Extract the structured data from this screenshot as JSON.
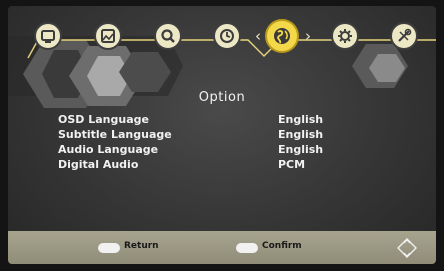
{
  "menu": {
    "title": "Option",
    "items": [
      {
        "label": "OSD Language",
        "value": "English"
      },
      {
        "label": "Subtitle Language",
        "value": "English"
      },
      {
        "label": "Audio Language",
        "value": "English"
      },
      {
        "label": "Digital Audio",
        "value": "PCM"
      }
    ]
  },
  "footer": {
    "return_label": "Return",
    "confirm_label": "Confirm"
  },
  "tabs": [
    {
      "icon": "tv-icon",
      "selected": false
    },
    {
      "icon": "picture-icon",
      "selected": false
    },
    {
      "icon": "search-icon",
      "selected": false
    },
    {
      "icon": "clock-icon",
      "selected": false
    },
    {
      "icon": "globe-icon",
      "selected": true
    },
    {
      "icon": "gear-icon",
      "selected": false
    },
    {
      "icon": "tools-icon",
      "selected": false
    }
  ],
  "colors": {
    "accent": "#f3d84a",
    "icon_bg": "#ece7c5",
    "footer": "#a7a48e",
    "text": "#f1f1f1"
  }
}
